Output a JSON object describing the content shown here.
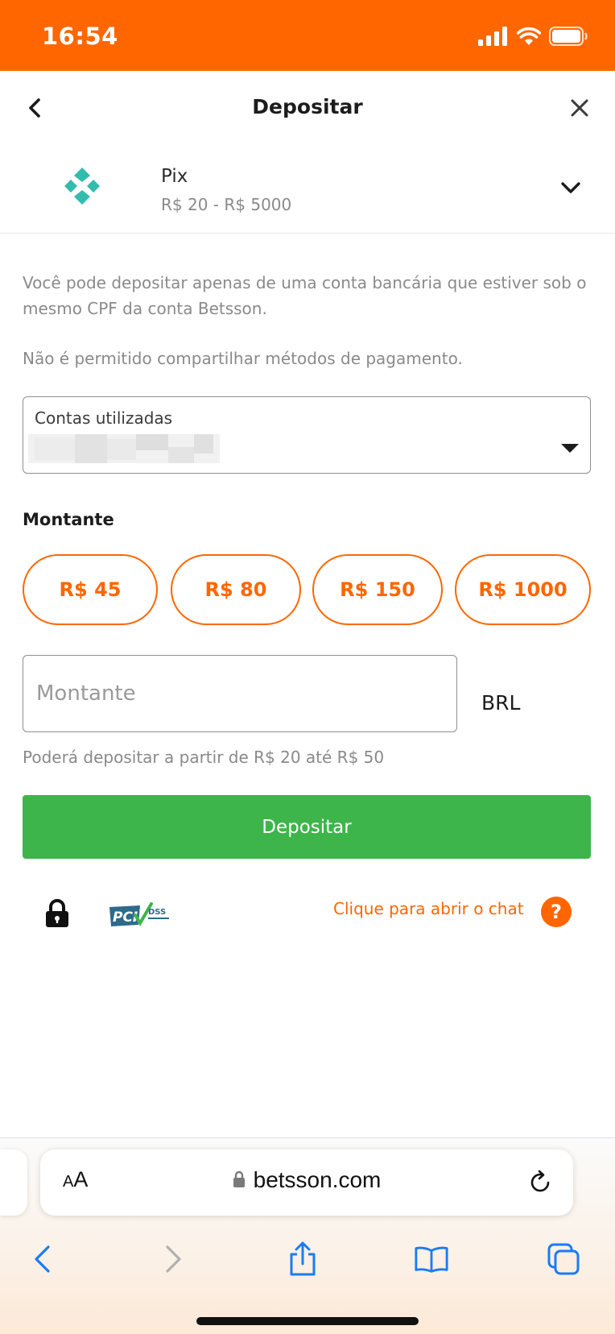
{
  "status_bar": {
    "time": "16:54"
  },
  "header": {
    "title": "Depositar"
  },
  "method": {
    "name": "Pix",
    "range": "R$ 20 - R$ 5000"
  },
  "info": {
    "line1": "Você pode depositar apenas de uma conta bancária que estiver sob o mesmo CPF da conta Betsson.",
    "line2": "Não é permitido compartilhar métodos de pagamento."
  },
  "account_select": {
    "label": "Contas utilizadas"
  },
  "amount": {
    "title": "Montante",
    "chips": [
      "R$ 45",
      "R$ 80",
      "R$ 150",
      "R$ 1000"
    ],
    "placeholder": "Montante",
    "currency": "BRL",
    "hint": "Poderá depositar a partir de R$ 20 até R$ 50"
  },
  "deposit_button": {
    "label": "Depositar"
  },
  "footer": {
    "chat_link": "Clique para abrir o chat",
    "help_symbol": "?",
    "pci_text": "PCI",
    "dss_text": "DSS"
  },
  "safari": {
    "aa_small": "A",
    "aa_large": "A",
    "url": "betsson.com"
  },
  "colors": {
    "brand_orange": "#ff6600",
    "deposit_green": "#3db54a",
    "pix_teal": "#32bcad"
  },
  "icons": [
    "back-chevron-icon",
    "close-icon",
    "pix-icon",
    "chevron-down-icon",
    "dropdown-arrow-icon",
    "lock-icon",
    "pci-dss-badge",
    "help-icon",
    "url-lock-icon",
    "reload-icon",
    "back-icon",
    "forward-icon",
    "share-icon",
    "bookmarks-icon",
    "tabs-icon"
  ]
}
